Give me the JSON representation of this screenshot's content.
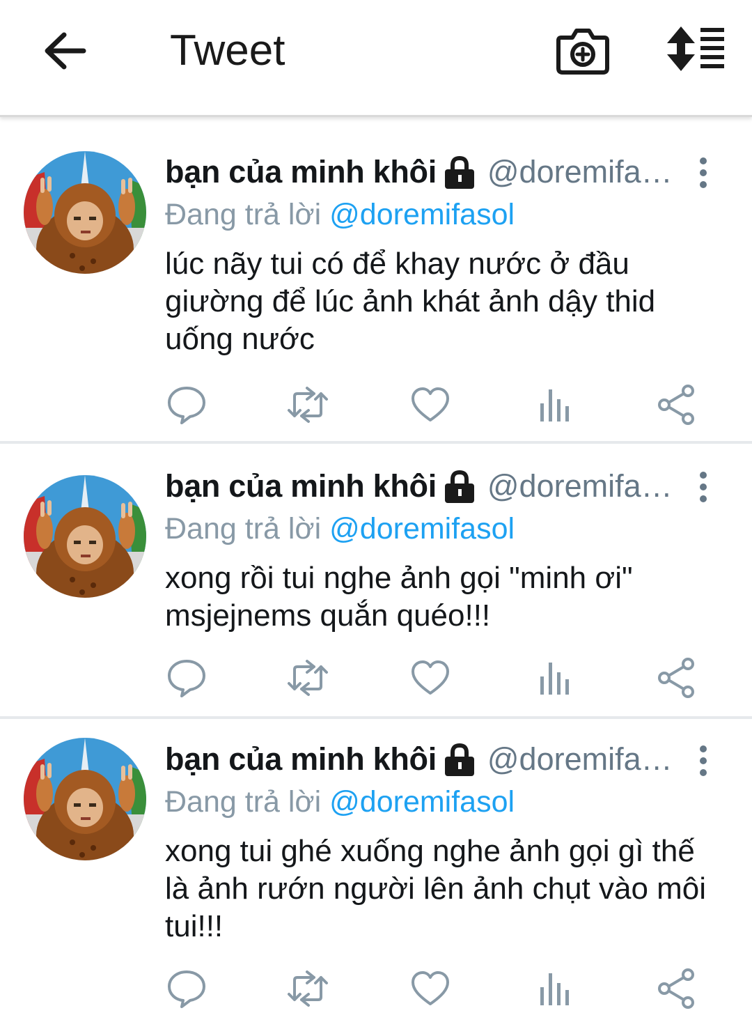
{
  "header": {
    "back_icon": "arrow-left-icon",
    "title": "Tweet",
    "camera_icon": "camera-plus-icon",
    "sort_icon": "sort-list-icon"
  },
  "colors": {
    "text": "#14171a",
    "muted": "#657786",
    "reply_muted": "#8899a6",
    "accent": "#1da1f2",
    "action_icon": "#8899a6",
    "divider": "#e6e9ec"
  },
  "tweets": [
    {
      "name": "bạn của minh khôi",
      "handle": "@doremifa…",
      "reply_prefix": "Đang trả lời",
      "reply_to": "@doremifasol",
      "text": "lúc nãy tui có để khay nước ở đầu giường để lúc ảnh khát ảnh dậy thid uống nước"
    },
    {
      "name": "bạn của minh khôi",
      "handle": "@doremifa…",
      "reply_prefix": "Đang trả lời",
      "reply_to": "@doremifasol",
      "text": "xong rồi tui nghe ảnh gọi \"minh ơi\" msjejnems quắn quéo!!!"
    },
    {
      "name": "bạn của minh khôi",
      "handle": "@doremifa…",
      "reply_prefix": "Đang trả lời",
      "reply_to": "@doremifasol",
      "text": "xong tui ghé xuống nghe ảnh gọi gì thế là ảnh rướn người lên ảnh chụt vào môi tui!!!"
    }
  ],
  "action_icons": [
    "reply-icon",
    "retweet-icon",
    "like-icon",
    "analytics-icon",
    "share-icon"
  ]
}
